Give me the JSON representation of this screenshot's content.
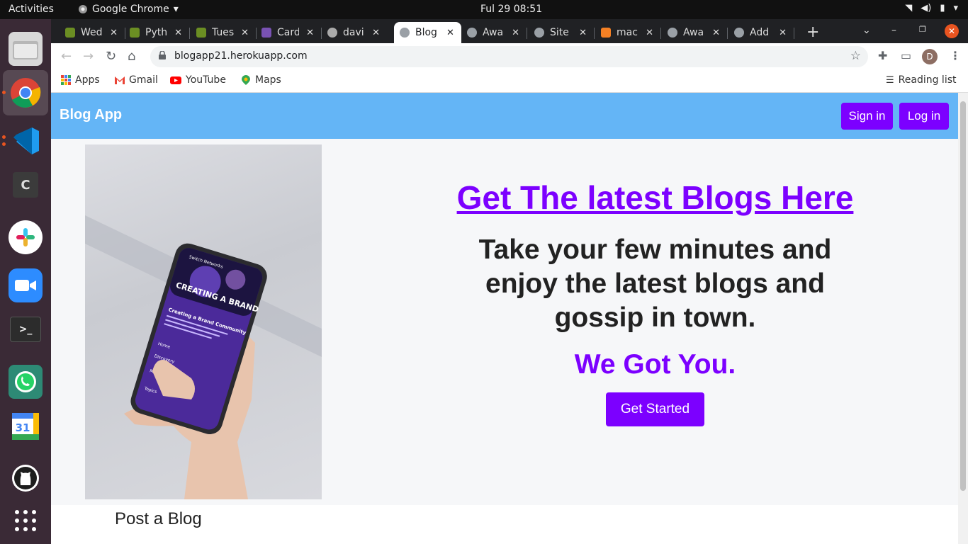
{
  "system": {
    "activities": "Activities",
    "app_name": "Google Chrome",
    "clock": "Ful 29  08:51"
  },
  "browser": {
    "tabs": [
      {
        "title": "Wed",
        "icon": "plant-icon"
      },
      {
        "title": "Pyth",
        "icon": "plant-icon"
      },
      {
        "title": "Tues",
        "icon": "plant-icon"
      },
      {
        "title": "Card",
        "icon": "bootstrap-icon"
      },
      {
        "title": "davi",
        "icon": "github-icon"
      },
      {
        "title": "Blog",
        "icon": "globe-icon",
        "active": true
      },
      {
        "title": "Awa",
        "icon": "globe-icon"
      },
      {
        "title": "Site",
        "icon": "globe-icon"
      },
      {
        "title": "mac",
        "icon": "stackoverflow-icon"
      },
      {
        "title": "Awa",
        "icon": "globe-icon"
      },
      {
        "title": "Add",
        "icon": "globe-icon"
      }
    ],
    "url": "blogapp21.herokuapp.com",
    "profile_initial": "D",
    "bookmarks": {
      "apps": "Apps",
      "gmail": "Gmail",
      "youtube": "YouTube",
      "maps": "Maps",
      "reading_list": "Reading list"
    }
  },
  "page": {
    "brand": "Blog App",
    "signin": "Sign in",
    "login": "Log in",
    "headline": "Get The latest Blogs Here",
    "tagline": "Take your few minutes and enjoy the latest blogs and gossip in town.",
    "subtag": "We Got You.",
    "cta": "Get Started",
    "phone_screen": {
      "network": "Switch Networks",
      "banner": "CREATING A BRAND",
      "heading": "Creating a Brand Community",
      "menu": [
        "Home",
        "Discovery",
        "Members",
        "Topics"
      ]
    },
    "post_title": "Post a Blog"
  },
  "colors": {
    "accent": "#7c00ff",
    "navbar": "#64b5f6",
    "background": "#f6f7f9"
  }
}
